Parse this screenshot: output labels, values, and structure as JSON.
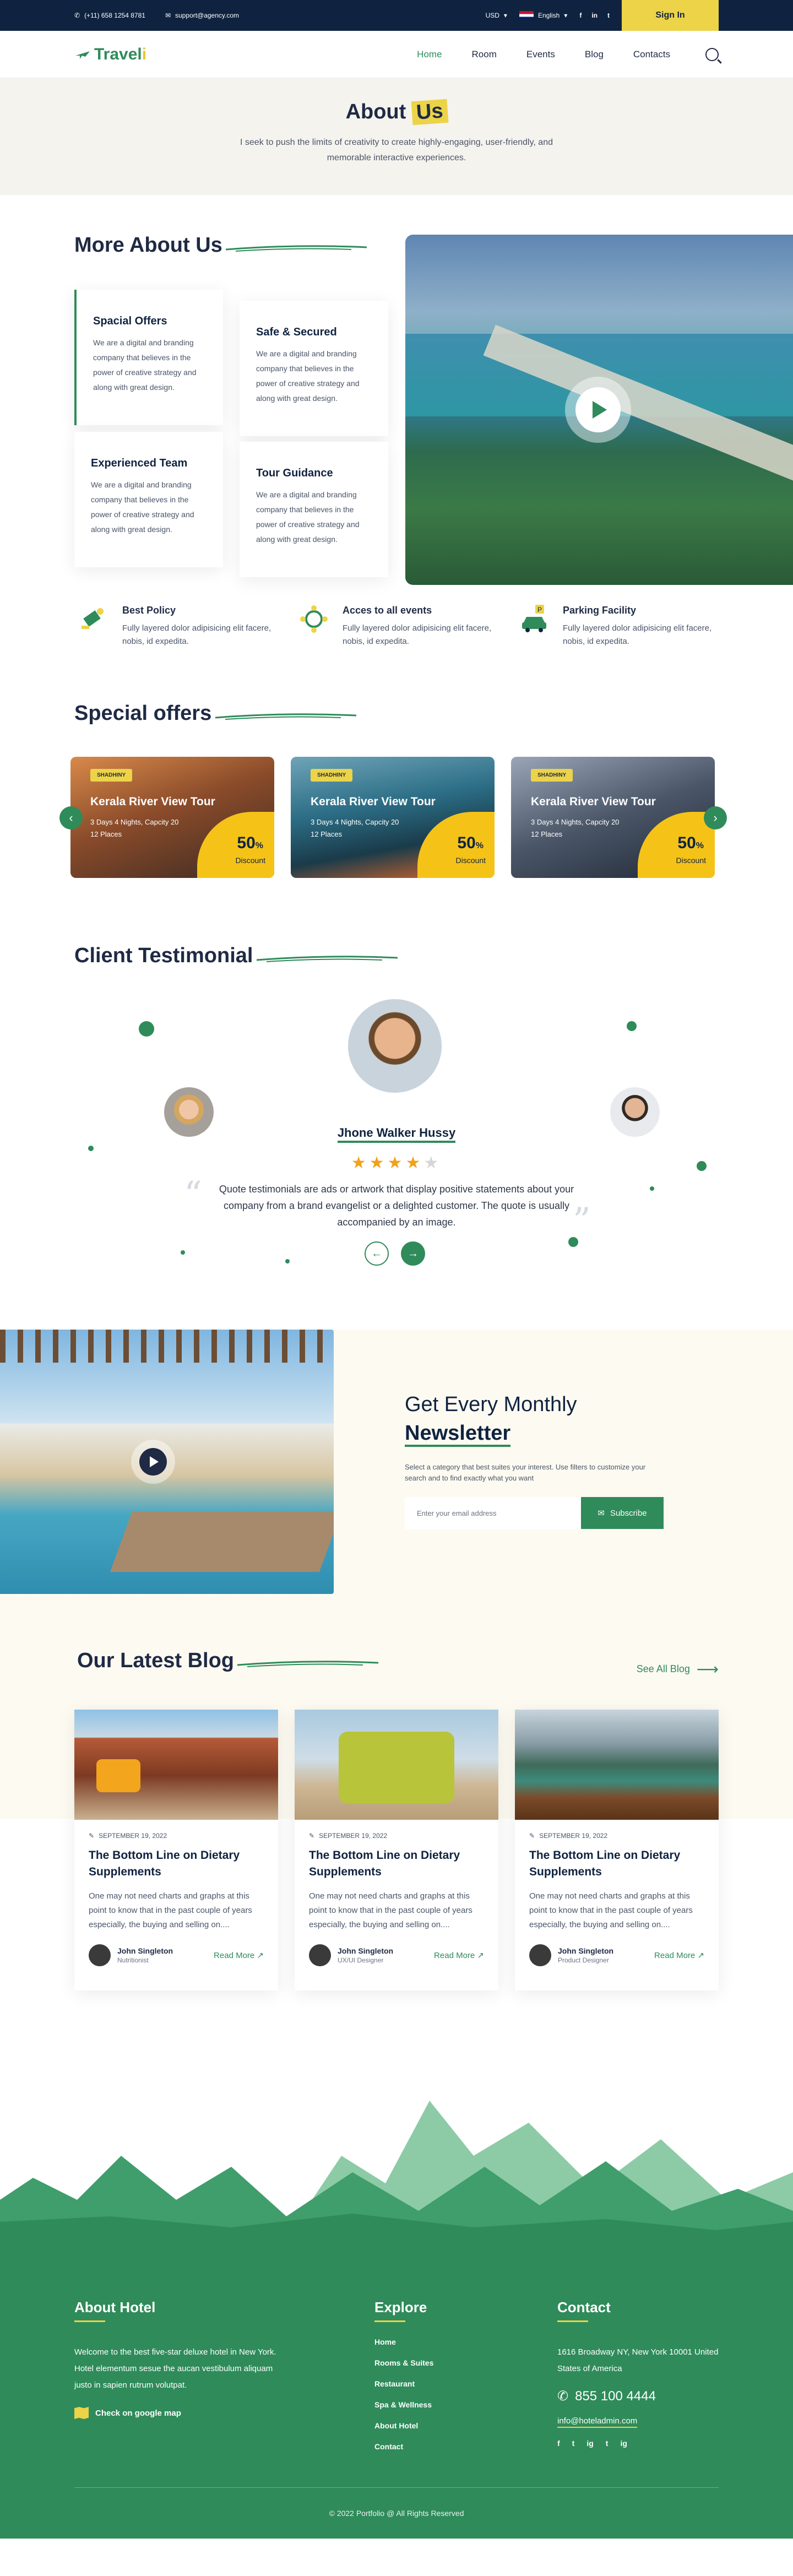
{
  "topbar": {
    "phone": "(+11) 658 1254 8781",
    "email": "support@agency.com",
    "currency": "USD",
    "language": "English",
    "social": [
      "f",
      "in",
      "t"
    ],
    "signin_label": "Sign In"
  },
  "brand": {
    "logo": "Travel",
    "logo_accent": "i"
  },
  "nav": {
    "items": [
      {
        "label": "Home",
        "active": true
      },
      {
        "label": "Room",
        "active": false
      },
      {
        "label": "Events",
        "active": false
      },
      {
        "label": "Blog",
        "active": false
      },
      {
        "label": "Contacts",
        "active": false
      }
    ]
  },
  "hero": {
    "title": "About",
    "title_highlight": "Us",
    "text": "I seek to push the limits of creativity to create highly-engaging, user-friendly, and memorable interactive experiences."
  },
  "more_about": {
    "title": "More About Us",
    "cards": [
      {
        "title": "Spacial Offers",
        "text": "We are a digital and branding company that believes in the power of creative strategy and along with great design."
      },
      {
        "title": "Safe & Secured",
        "text": "We are a digital and branding company that believes in the power of creative strategy and along with great design."
      },
      {
        "title": "Experienced Team",
        "text": "We are a digital and branding company that believes in the power of creative strategy and along with great design."
      },
      {
        "title": "Tour Guidance",
        "text": "We are a digital and branding company that believes in the power of creative strategy and along with great design."
      }
    ]
  },
  "features": [
    {
      "title": "Best Policy",
      "text": "Fully layered dolor adipisicing elit facere, nobis, id expedita."
    },
    {
      "title": "Acces to all events",
      "text": "Fully layered dolor adipisicing elit facere, nobis, id expedita."
    },
    {
      "title": "Parking Facility",
      "text": "Fully layered dolor adipisicing elit facere, nobis, id expedita."
    }
  ],
  "offers": {
    "title": "Special offers",
    "cards": [
      {
        "tag": "SHADHINY",
        "title": "Kerala River View Tour",
        "meta": "3 Days 4 Nights, Capcity 20",
        "places": "12 Places",
        "discount": "50",
        "discount_unit": "%",
        "discount_label": "Discount"
      },
      {
        "tag": "SHADHINY",
        "title": "Kerala River View Tour",
        "meta": "3 Days 4 Nights, Capcity 20",
        "places": "12 Places",
        "discount": "50",
        "discount_unit": "%",
        "discount_label": "Discount"
      },
      {
        "tag": "SHADHINY",
        "title": "Kerala River View Tour",
        "meta": "3 Days 4 Nights, Capcity 20",
        "places": "12 Places",
        "discount": "50",
        "discount_unit": "%",
        "discount_label": "Discount"
      }
    ]
  },
  "testimonial": {
    "title": "Client Testimonial",
    "name": "Jhone Walker Hussy",
    "rating": 4,
    "rating_max": 5,
    "quote": "Quote testimonials are ads or artwork that display positive statements about your company from a brand evangelist or a delighted customer. The quote is usually accompanied by an image."
  },
  "newsletter": {
    "title_line1": "Get Every Monthly",
    "title_line2": "Newsletter",
    "text": "Select a category that best suites your interest. Use filters to customize your search and to find exactly what you want",
    "placeholder": "Enter your email address",
    "button": "Subscribe"
  },
  "blog": {
    "title": "Our Latest Blog",
    "see_all": "See All Blog",
    "posts": [
      {
        "date": "SEPTEMBER 19, 2022",
        "title": "The Bottom Line on Dietary Supplements",
        "text": "One may not need charts and graphs at this point to know that in the past couple of years especially, the buying and selling on....",
        "author": "John Singleton",
        "role": "Nutritionist",
        "read_more": "Read More"
      },
      {
        "date": "SEPTEMBER 19, 2022",
        "title": "The Bottom Line on Dietary Supplements",
        "text": "One may not need charts and graphs at this point to know that in the past couple of years especially, the buying and selling on....",
        "author": "John Singleton",
        "role": "UX/UI Designer",
        "read_more": "Read More"
      },
      {
        "date": "SEPTEMBER 19, 2022",
        "title": "The Bottom Line on Dietary Supplements",
        "text": "One may not need charts and graphs at this point to know that in the past couple of years especially, the buying and selling on....",
        "author": "John Singleton",
        "role": "Product Designer",
        "read_more": "Read More"
      }
    ]
  },
  "footer": {
    "about_title": "About Hotel",
    "about_text": "Welcome to the best five-star deluxe hotel in New York. Hotel elementum sesue the aucan vestibulum aliquam justo in sapien rutrum volutpat.",
    "map_link": "Check on google map",
    "explore_title": "Explore",
    "explore_links": [
      "Home",
      "Rooms & Suites",
      "Restaurant",
      "Spa & Wellness",
      "About Hotel",
      "Contact"
    ],
    "contact_title": "Contact",
    "address": "1616 Broadway NY, New York 10001 United States of America",
    "phone": "855 100 4444",
    "email": "info@hoteladmin.com",
    "social": [
      "f",
      "t",
      "ig",
      "t",
      "ig"
    ],
    "copyright": "© 2022 Portfolio @ All Rights Reserved"
  },
  "colors": {
    "primary": "#2f8b5a",
    "accent": "#ecd348",
    "navy": "#0f2340",
    "cream": "#fdfaf1"
  }
}
